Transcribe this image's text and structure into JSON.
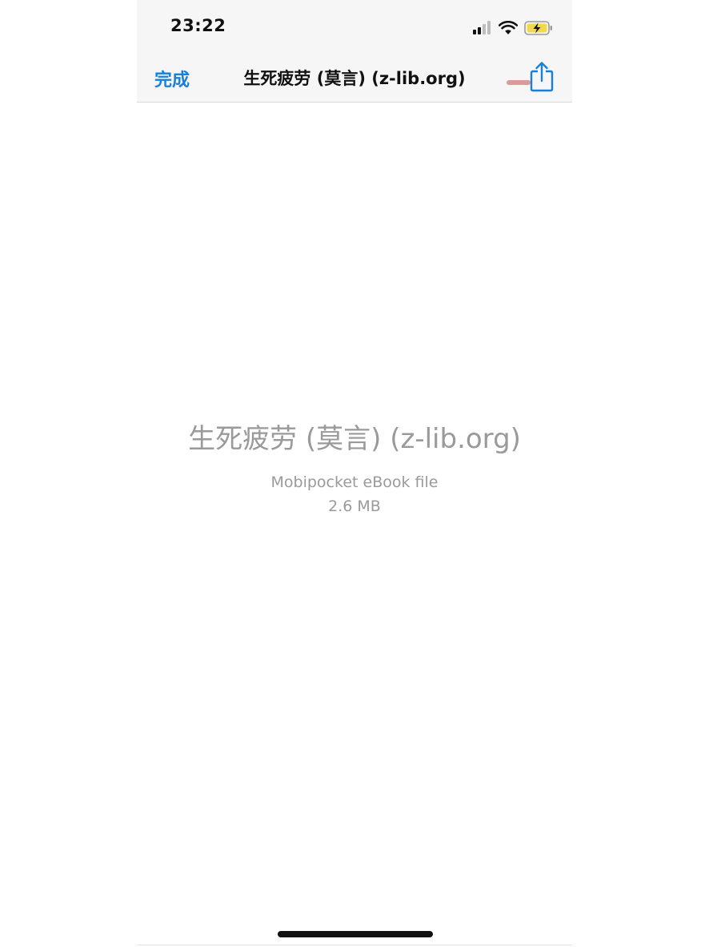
{
  "status_bar": {
    "time": "23:22"
  },
  "nav": {
    "done_label": "完成",
    "title": "生死疲劳 (莫言) (z-lib.org)"
  },
  "file": {
    "name": "生死疲劳 (莫言) (z-lib.org)",
    "type": "Mobipocket eBook file",
    "size": "2.6 MB"
  },
  "icons": {
    "signal": "cellular-signal-icon",
    "wifi": "wifi-icon",
    "battery": "battery-charging-icon",
    "share": "share-icon"
  },
  "colors": {
    "accent": "#1a7fd6",
    "battery_fill": "#f2d94a",
    "muted_text": "#9a9a9a"
  }
}
